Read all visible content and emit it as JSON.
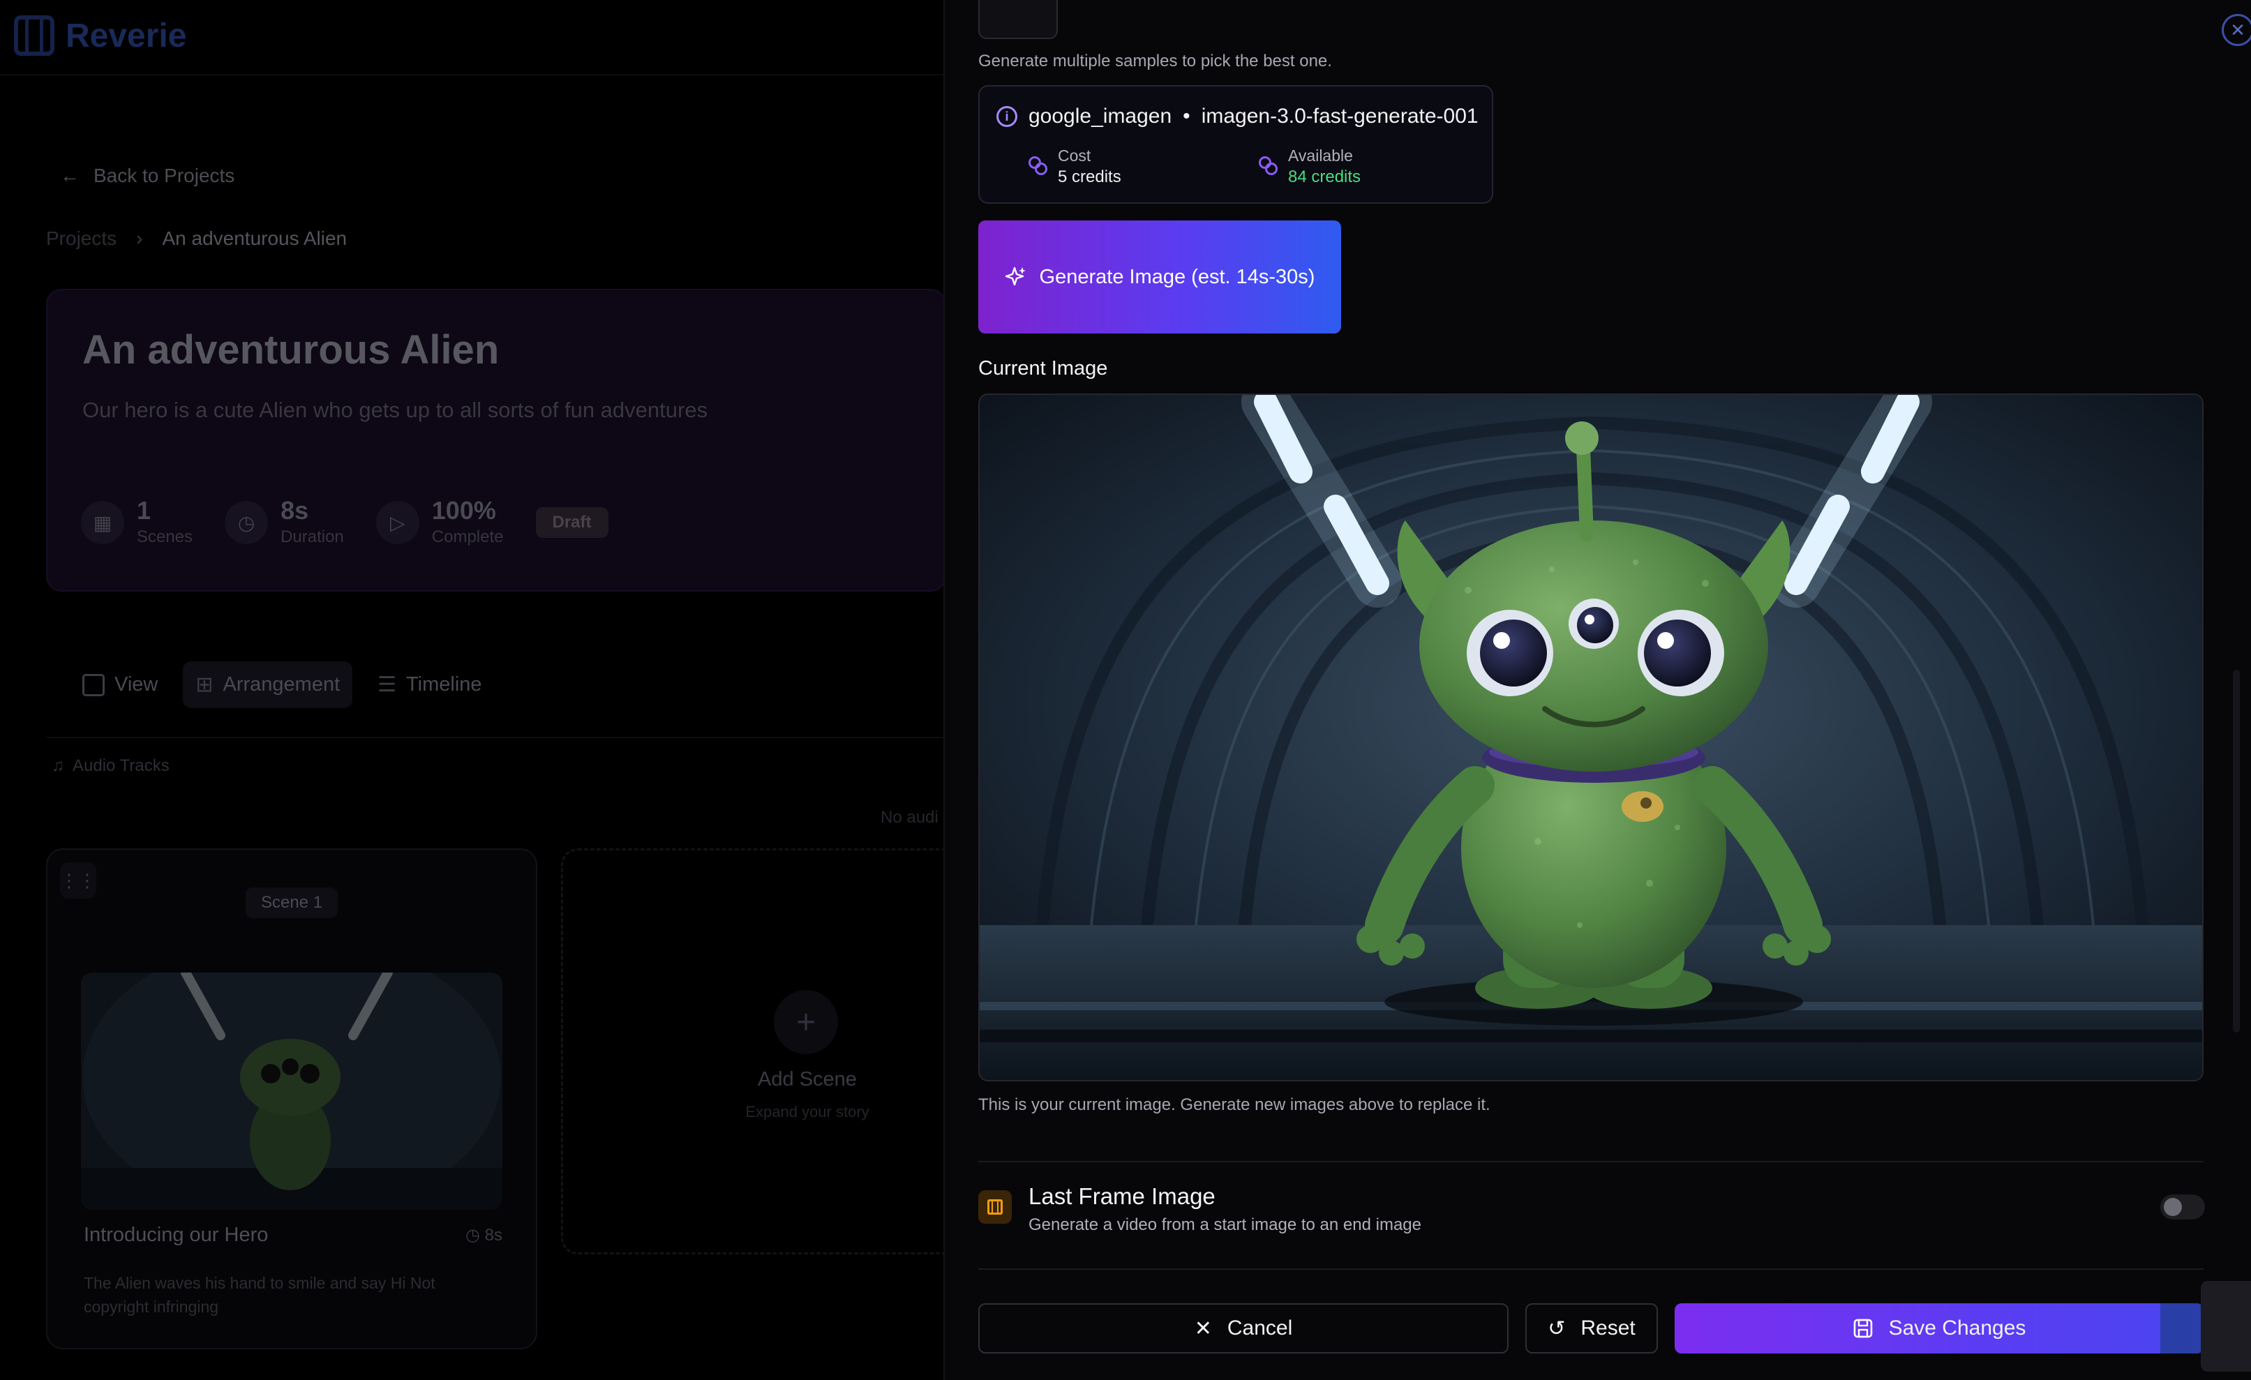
{
  "app": {
    "brand": "Reverie"
  },
  "left": {
    "back_label": "Back to Projects",
    "breadcrumb": [
      "Projects",
      "An adventurous Alien"
    ],
    "project": {
      "title": "An adventurous Alien",
      "description": "Our hero is a cute Alien who gets up to all sorts of fun adventures",
      "stats": [
        {
          "value": "1",
          "label": "Scenes",
          "icon": "film-icon"
        },
        {
          "value": "8s",
          "label": "Duration",
          "icon": "clock-icon"
        },
        {
          "value": "100%",
          "label": "Complete",
          "icon": "play-icon"
        }
      ],
      "status": "Draft"
    },
    "tabs": [
      "View",
      "Arrangement",
      "Timeline"
    ],
    "audio_label": "Audio Tracks",
    "no_audio": "No audi",
    "scene": {
      "tag": "Scene 1",
      "title": "Introducing our Hero",
      "duration": "8s",
      "description": "The Alien waves his hand to smile and say Hi Not copyright infringing"
    },
    "add_scene": {
      "title": "Add Scene",
      "subtitle": "Expand your story"
    }
  },
  "panel": {
    "samples_hint": "Generate multiple samples to pick the best one.",
    "model": {
      "provider": "google_imagen",
      "separator": "•",
      "name": "imagen-3.0-fast-generate-001",
      "cost_label": "Cost",
      "cost_value": "5 credits",
      "available_label": "Available",
      "available_value": "84 credits"
    },
    "generate_label": "Generate Image (est. 14s-30s)",
    "current_image_label": "Current Image",
    "current_image_hint": "This is your current image. Generate new images above to replace it.",
    "last_frame": {
      "title": "Last Frame Image",
      "subtitle": "Generate a video from a start image to an end image",
      "enabled": false
    },
    "buttons": {
      "cancel": "Cancel",
      "reset": "Reset",
      "save": "Save Changes"
    }
  },
  "colors": {
    "accent_purple": "#7c2ef0",
    "accent_blue": "#2f5bf0",
    "available_green": "#4ade80",
    "amber_icon": "#f59e0b"
  }
}
